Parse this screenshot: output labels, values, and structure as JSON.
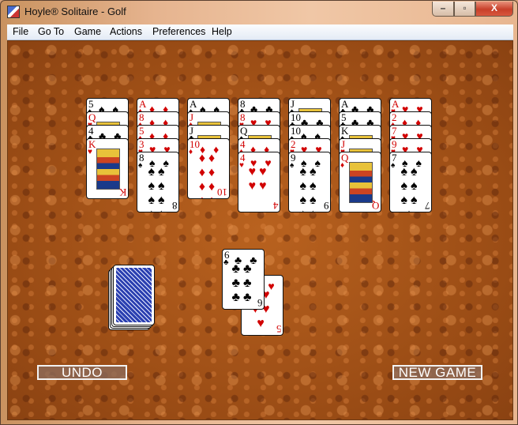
{
  "window": {
    "title": "Hoyle® Solitaire - Golf",
    "controls": {
      "minimize": "–",
      "maximize": "▫",
      "close": "X"
    }
  },
  "menu": [
    "File",
    "Go To",
    "Game",
    "Actions",
    "Preferences",
    "Help"
  ],
  "tableau": [
    {
      "cards": [
        {
          "rank": "5",
          "suit": "♠",
          "color": "black"
        },
        {
          "rank": "Q",
          "suit": "♥",
          "color": "red"
        },
        {
          "rank": "4",
          "suit": "♣",
          "color": "black"
        },
        {
          "rank": "K",
          "suit": "♥",
          "color": "red"
        }
      ]
    },
    {
      "cards": [
        {
          "rank": "A",
          "suit": "♦",
          "color": "red"
        },
        {
          "rank": "8",
          "suit": "♦",
          "color": "red"
        },
        {
          "rank": "5",
          "suit": "♦",
          "color": "red"
        },
        {
          "rank": "3",
          "suit": "♥",
          "color": "red"
        },
        {
          "rank": "8",
          "suit": "♠",
          "color": "black"
        }
      ]
    },
    {
      "cards": [
        {
          "rank": "A",
          "suit": "♠",
          "color": "black"
        },
        {
          "rank": "J",
          "suit": "♦",
          "color": "red"
        },
        {
          "rank": "J",
          "suit": "♣",
          "color": "black"
        },
        {
          "rank": "10",
          "suit": "♦",
          "color": "red"
        }
      ]
    },
    {
      "cards": [
        {
          "rank": "8",
          "suit": "♣",
          "color": "black"
        },
        {
          "rank": "8",
          "suit": "♥",
          "color": "red"
        },
        {
          "rank": "Q",
          "suit": "♠",
          "color": "black"
        },
        {
          "rank": "4",
          "suit": "♦",
          "color": "red"
        },
        {
          "rank": "4",
          "suit": "♥",
          "color": "red"
        }
      ]
    },
    {
      "cards": [
        {
          "rank": "J",
          "suit": "♠",
          "color": "black"
        },
        {
          "rank": "10",
          "suit": "♣",
          "color": "black"
        },
        {
          "rank": "10",
          "suit": "♠",
          "color": "black"
        },
        {
          "rank": "2",
          "suit": "♥",
          "color": "red"
        },
        {
          "rank": "9",
          "suit": "♠",
          "color": "black"
        }
      ]
    },
    {
      "cards": [
        {
          "rank": "A",
          "suit": "♣",
          "color": "black"
        },
        {
          "rank": "5",
          "suit": "♣",
          "color": "black"
        },
        {
          "rank": "K",
          "suit": "♠",
          "color": "black"
        },
        {
          "rank": "J",
          "suit": "♥",
          "color": "red"
        },
        {
          "rank": "Q",
          "suit": "♦",
          "color": "red"
        }
      ]
    },
    {
      "cards": [
        {
          "rank": "A",
          "suit": "♥",
          "color": "red"
        },
        {
          "rank": "2",
          "suit": "♦",
          "color": "red"
        },
        {
          "rank": "7",
          "suit": "♥",
          "color": "red"
        },
        {
          "rank": "9",
          "suit": "♥",
          "color": "red"
        },
        {
          "rank": "7",
          "suit": "♠",
          "color": "black"
        }
      ]
    }
  ],
  "stock": {
    "label": "stock pile (face down)"
  },
  "waste": [
    {
      "rank": "5",
      "suit": "♥",
      "color": "red"
    },
    {
      "rank": "6",
      "suit": "♣",
      "color": "black"
    }
  ],
  "buttons": {
    "undo": "UNDO",
    "new_game": "NEW GAME"
  }
}
